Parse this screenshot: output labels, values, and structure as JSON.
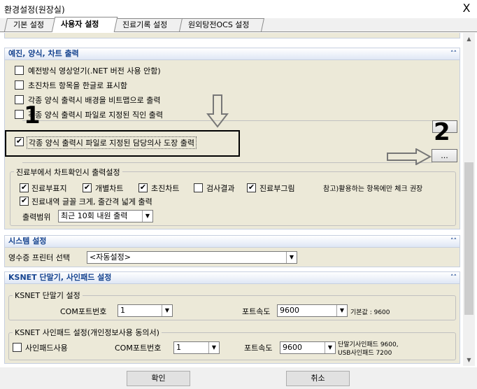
{
  "window": {
    "title": "환경설정(원장실)",
    "close_glyph": "X"
  },
  "tabs": [
    {
      "label": "기본 설정"
    },
    {
      "label": "사용자 설정"
    },
    {
      "label": "진료기록 설정"
    },
    {
      "label": "원외탕전OCS 설정"
    }
  ],
  "sections": {
    "print": {
      "title": "예진, 양식, 차트 출력",
      "options": [
        {
          "label": "예전방식  영상얻기(.NET 버전 사용 안함)",
          "checked": false
        },
        {
          "label": "초진차트 항목을 한글로 표시함",
          "checked": false
        },
        {
          "label": "각종 양식 출력시 배경을 비트맵으로 출력",
          "checked": false
        },
        {
          "label": "각종 양식 출력시 파일로 지정된 직인 출력",
          "checked": false
        },
        {
          "label": "각종 양식 출력시 파일로 지정된 담당의사 도장 출력",
          "checked": true
        }
      ],
      "browse_button": "...",
      "chart_group": {
        "title": "진료부에서 차트확인시 출력설정",
        "items": [
          {
            "label": "진료부표지",
            "checked": true
          },
          {
            "label": "개별차트",
            "checked": true
          },
          {
            "label": "초진차트",
            "checked": true
          },
          {
            "label": "검사결과",
            "checked": false
          },
          {
            "label": "진료부그림",
            "checked": true
          }
        ],
        "note": "참고)활용하는 항목에만 체크 권장",
        "large_text": {
          "label": "진료내역 글꼴 크게, 줄간격 넓게 출력",
          "checked": true
        },
        "range_label": "출력범위",
        "range_value": "최근 10회 내원 출력"
      }
    },
    "system": {
      "title": "시스템 설정",
      "receipt_label": "영수증 프린터 선택",
      "receipt_value": "<자동설정>"
    },
    "ksnet": {
      "title": "KSNET 단말기, 사인패드 설정",
      "terminal": {
        "title": "KSNET 단말기 설정",
        "port_label": "COM포트번호",
        "port_value": "1",
        "speed_label": "포트속도",
        "speed_value": "9600",
        "default_note": "기본값 : 9600"
      },
      "signpad": {
        "title": "KSNET 사인패드 설정(개인정보사용 동의서)",
        "use_label": "사인패드사용",
        "use_checked": false,
        "port_label": "COM포트번호",
        "port_value": "1",
        "speed_label": "포트속도",
        "speed_value": "9600",
        "note_line1": "단말기사인패드  9600,",
        "note_line2": "USB사인패드   7200"
      }
    }
  },
  "annotations": {
    "marker1": "1",
    "marker2": "2"
  },
  "footer": {
    "ok": "확인",
    "cancel": "취소"
  },
  "colors": {
    "section_title": "#15438f",
    "highlight_box": "#000000"
  }
}
